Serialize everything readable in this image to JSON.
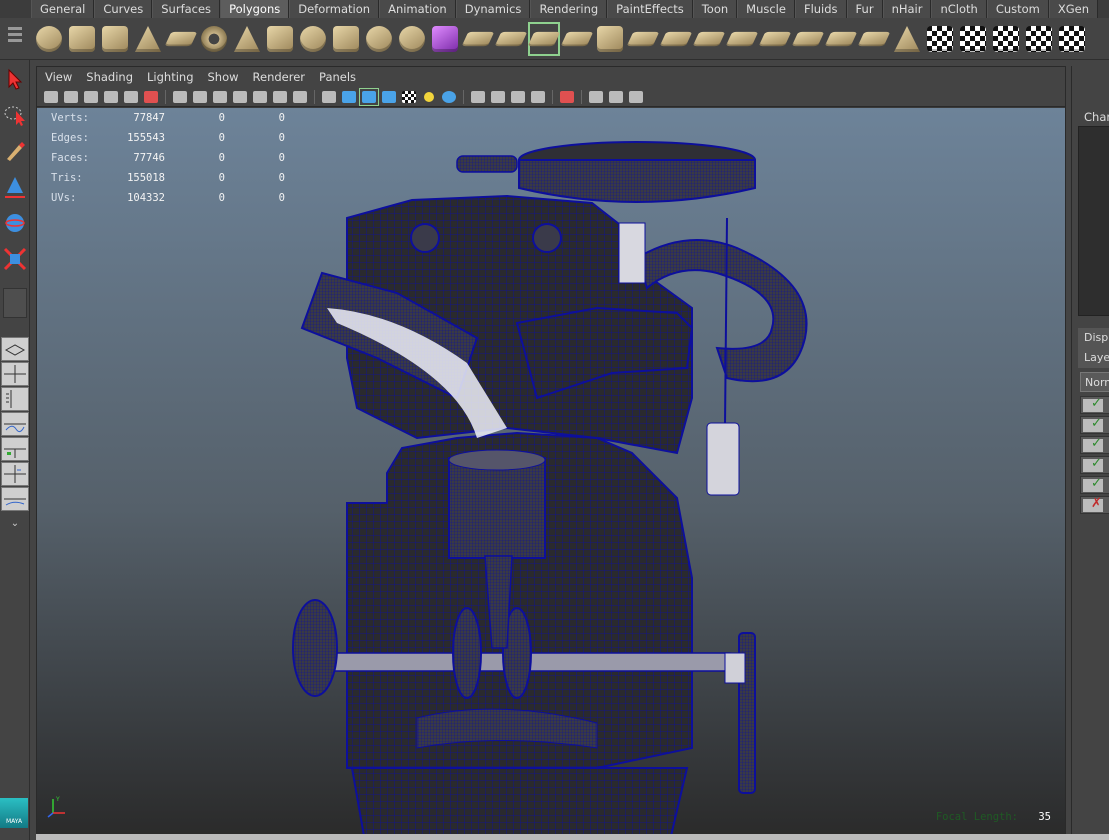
{
  "shelf": {
    "tabs": [
      "General",
      "Curves",
      "Surfaces",
      "Polygons",
      "Deformation",
      "Animation",
      "Dynamics",
      "Rendering",
      "PaintEffects",
      "Toon",
      "Muscle",
      "Fluids",
      "Fur",
      "nHair",
      "nCloth",
      "Custom",
      "XGen"
    ],
    "active_tab": "Polygons",
    "icons": [
      {
        "name": "poly-sphere-icon",
        "kind": "sphere"
      },
      {
        "name": "poly-cube-icon",
        "kind": "cube"
      },
      {
        "name": "poly-cylinder-icon",
        "kind": "cube"
      },
      {
        "name": "poly-cone-icon",
        "kind": "cone"
      },
      {
        "name": "poly-plane-icon",
        "kind": "plane"
      },
      {
        "name": "poly-torus-icon",
        "kind": "torus"
      },
      {
        "name": "poly-pyramid-icon",
        "kind": "cone"
      },
      {
        "name": "poly-pipe-icon",
        "kind": "cube"
      },
      {
        "name": "poly-soccer-ball-icon",
        "kind": "sphere"
      },
      {
        "name": "poly-combine-icon",
        "kind": "cube"
      },
      {
        "name": "poly-separate-icon",
        "kind": "sphere"
      },
      {
        "name": "poly-smooth-icon",
        "kind": "sphere"
      },
      {
        "name": "poly-purple-cube-icon",
        "kind": "purple"
      },
      {
        "name": "poly-bridge-icon",
        "kind": "plane"
      },
      {
        "name": "poly-extrude-icon",
        "kind": "plane"
      },
      {
        "name": "poly-split-icon",
        "kind": "plane"
      },
      {
        "name": "poly-merge-icon",
        "kind": "plane"
      },
      {
        "name": "poly-bevel-icon",
        "kind": "cube"
      },
      {
        "name": "poly-fill-hole-icon",
        "kind": "plane"
      },
      {
        "name": "poly-append-icon",
        "kind": "plane"
      },
      {
        "name": "poly-wedge-icon",
        "kind": "plane"
      },
      {
        "name": "poly-poke-icon",
        "kind": "plane"
      },
      {
        "name": "poly-collapse-icon",
        "kind": "plane"
      },
      {
        "name": "poly-triangulate-icon",
        "kind": "plane"
      },
      {
        "name": "poly-quadrangulate-icon",
        "kind": "plane"
      },
      {
        "name": "poly-reduce-icon",
        "kind": "plane"
      },
      {
        "name": "poly-sculpt-icon",
        "kind": "cone"
      },
      {
        "name": "uv-planar-icon",
        "kind": "checker"
      },
      {
        "name": "uv-cylindrical-icon",
        "kind": "checker"
      },
      {
        "name": "uv-spherical-icon",
        "kind": "checker"
      },
      {
        "name": "uv-automatic-icon",
        "kind": "checker"
      },
      {
        "name": "uv-editor-icon",
        "kind": "checker"
      }
    ],
    "selected_icon_index": 15
  },
  "panel": {
    "menus": [
      "View",
      "Shading",
      "Lighting",
      "Show",
      "Renderer",
      "Panels"
    ]
  },
  "hud": {
    "rows": [
      {
        "label": "Verts:",
        "v": "77847",
        "a": "0",
        "b": "0"
      },
      {
        "label": "Edges:",
        "v": "155543",
        "a": "0",
        "b": "0"
      },
      {
        "label": "Faces:",
        "v": "77746",
        "a": "0",
        "b": "0"
      },
      {
        "label": "Tris:",
        "v": "155018",
        "a": "0",
        "b": "0"
      },
      {
        "label": "UVs:",
        "v": "104332",
        "a": "0",
        "b": "0"
      }
    ],
    "focal_label": "Focal Length:",
    "focal_value": "35",
    "axis_label": "Y"
  },
  "channel_box": {
    "title": "Chan",
    "display_tab": "Displ",
    "layer_tab": "Laye",
    "layer_mode": "Norm",
    "layers": [
      true,
      true,
      true,
      true,
      true,
      false
    ]
  },
  "logo_text": "MAYA",
  "colors": {
    "wire": "#0d0f9c",
    "mesh": "#2a2a2e",
    "bg_top": "#6d8399",
    "bg_bottom": "#2a2a2a"
  }
}
